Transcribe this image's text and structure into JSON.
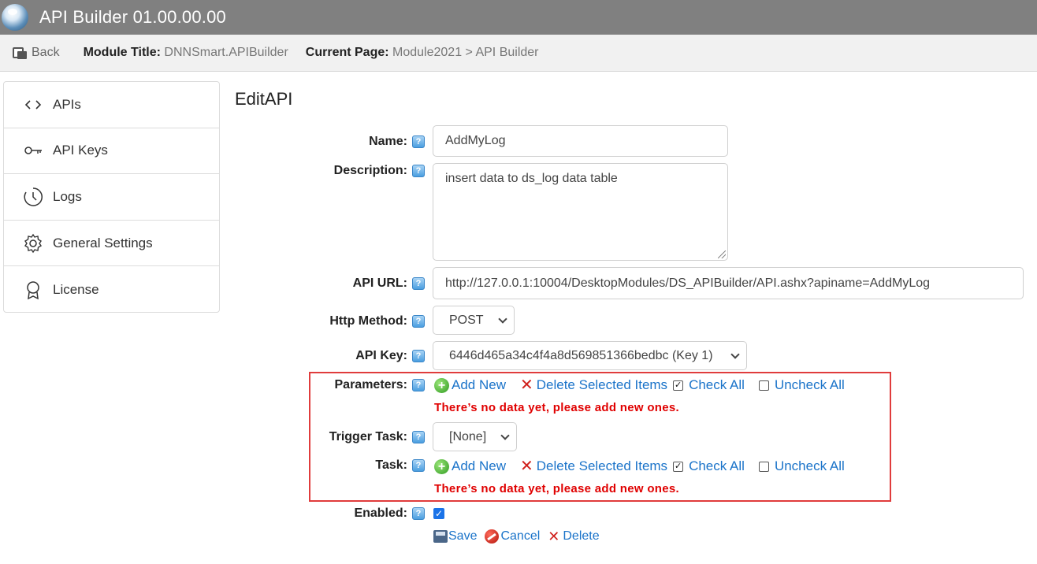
{
  "app": {
    "title": "API Builder 01.00.00.00"
  },
  "topbar": {
    "back_label": "Back",
    "module_title_label": "Module Title:",
    "module_title_value": "DNNSmart.APIBuilder",
    "current_page_label": "Current Page:",
    "current_page_value": "Module2021 > API Builder"
  },
  "sidebar": {
    "items": [
      {
        "label": "APIs",
        "icon": "code-icon"
      },
      {
        "label": "API Keys",
        "icon": "key-icon"
      },
      {
        "label": "Logs",
        "icon": "clock-icon"
      },
      {
        "label": "General Settings",
        "icon": "gear-icon"
      },
      {
        "label": "License",
        "icon": "award-icon"
      }
    ]
  },
  "page": {
    "title": "EditAPI"
  },
  "form": {
    "name": {
      "label": "Name:",
      "value": "AddMyLog"
    },
    "description": {
      "label": "Description:",
      "value": "insert data to ds_log data table"
    },
    "api_url": {
      "label": "API URL:",
      "value": "http://127.0.0.1:10004/DesktopModules/DS_APIBuilder/API.ashx?apiname=AddMyLog"
    },
    "http_method": {
      "label": "Http Method:",
      "value": "POST"
    },
    "api_key": {
      "label": "API Key:",
      "value": "6446d465a34c4f4a8d569851366bedbc (Key 1)"
    },
    "parameters": {
      "label": "Parameters:",
      "add_new": "Add New",
      "delete_selected": "Delete Selected Items",
      "check_all": "Check All",
      "uncheck_all": "Uncheck All",
      "empty_message": "There’s no data yet, please add new ones."
    },
    "trigger_task": {
      "label": "Trigger Task:",
      "value": "[None]"
    },
    "task": {
      "label": "Task:",
      "add_new": "Add New",
      "delete_selected": "Delete Selected Items",
      "check_all": "Check All",
      "uncheck_all": "Uncheck All",
      "empty_message": "There’s no data yet, please add new ones."
    },
    "enabled": {
      "label": "Enabled:",
      "checked": true
    },
    "help_glyph": "?"
  },
  "buttons": {
    "save": "Save",
    "cancel": "Cancel",
    "delete": "Delete"
  },
  "colors": {
    "link": "#1a73c9",
    "error": "#e00000",
    "highlight": "#e03c3c",
    "titlebar": "#808080"
  }
}
